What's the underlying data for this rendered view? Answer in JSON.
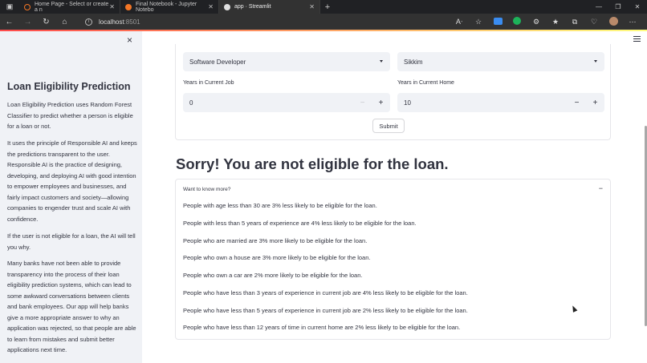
{
  "browser": {
    "tabs": [
      {
        "title": "Home Page - Select or create a n",
        "color": "#f37626"
      },
      {
        "title": "Final Notebook - Jupyter Notebo",
        "color": "#f37626"
      },
      {
        "title": "app · Streamlit",
        "color": "#e0e0e0"
      }
    ],
    "url_host": "localhost",
    "url_port": ":8501",
    "new_tab": "+"
  },
  "sidebar": {
    "close": "×",
    "title": "Loan Eligibility Prediction",
    "paragraphs": [
      "Loan Eligibility Prediction uses Random Forest Classifier to predict whether a person is eligible for a loan or not.",
      "It uses the principle of Responsible AI and keeps the predictions transparent to the user. Responsible AI is the practice of designing, developing, and deploying AI with good intention to empower employees and businesses, and fairly impact customers and society—allowing companies to engender trust and scale AI with confidence.",
      "If the user is not eligible for a loan, the AI will tell you why.",
      "Many banks have not been able to provide transparency into the process of their loan eligibility prediction systems, which can lead to some awkward conversations between clients and bank employees. Our app will help banks give a more appropriate answer to why an application was rejected, so that people are able to learn from mistakes and submit better applications next time."
    ]
  },
  "form": {
    "profession_value": "Software Developer",
    "state_value": "Sikkim",
    "job_years_label": "Years in Current Job",
    "job_years_value": "0",
    "home_years_label": "Years in Current Home",
    "home_years_value": "10",
    "minus": "−",
    "plus": "+",
    "submit_label": "Submit"
  },
  "result": {
    "message": "Sorry! You are not eligible for the loan.",
    "expander_label": "Want to know more?",
    "expander_toggle": "−",
    "reasons": [
      "People with age less than 30 are 3% less likely to be eligible for the loan.",
      "People with less than 5 years of experience are 4% less likely to be eligible for the loan.",
      "People who are married are 3% more likely to be eligible for the loan.",
      "People who own a house are 3% more likely to be eligible for the loan.",
      "People who own a car are 2% more likely to be eligible for the loan.",
      "People who have less than 3 years of experience in current job are 4% less likely to be eligible for the loan.",
      "People who have less than 5 years of experience in current job are 2% less likely to be eligible for the loan.",
      "People who have less than 12 years of time in current home are 2% less likely to be eligible for the loan."
    ]
  }
}
